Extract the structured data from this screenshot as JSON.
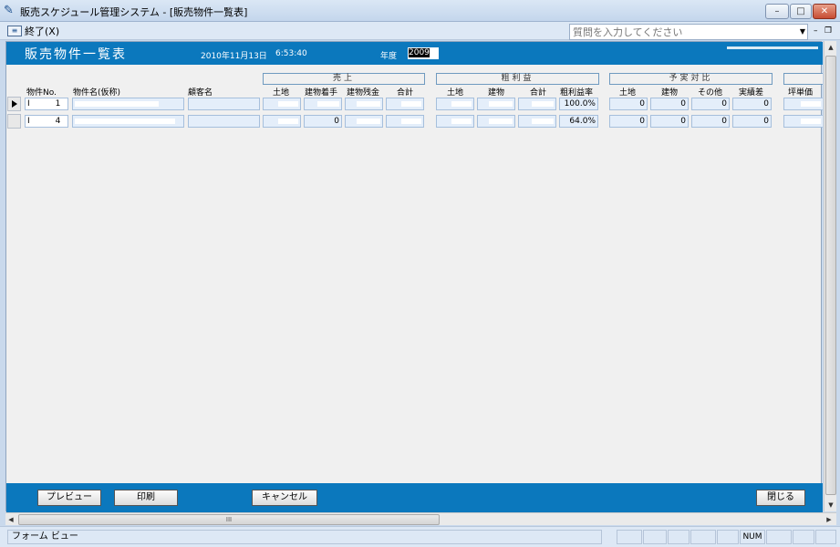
{
  "window": {
    "title": "販売スケジュール管理システム - [販売物件一覧表]",
    "min_glyph": "–",
    "max_glyph": "□",
    "close_glyph": "✕"
  },
  "menu": {
    "exit_label": "終了(X)",
    "help_placeholder": "質問を入力してください",
    "mdi_min": "–",
    "mdi_restore": "❐"
  },
  "header": {
    "title": "販売物件一覧表",
    "date": "2010年11月13日",
    "time": "6:53:40",
    "year_label": "年度",
    "year_value": "2009"
  },
  "groups": {
    "sales": "売上",
    "gross_profit": "粗利益",
    "budget_vs_actual": "予実対比"
  },
  "columns": {
    "property_no": "物件No.",
    "property_name": "物件名(仮称)",
    "customer": "顧客名",
    "sales_land": "土地",
    "sales_building_start": "建物着手",
    "sales_building_balance": "建物残金",
    "sales_total": "合計",
    "gp_land": "土地",
    "gp_building": "建物",
    "gp_total": "合計",
    "gp_rate": "粗利益率",
    "bva_land": "土地",
    "bva_building": "建物",
    "bva_other": "その他",
    "bva_diff": "実績差",
    "unit_price": "坪単価"
  },
  "rows": [
    {
      "no_prefix": "I",
      "no_suffix": "1",
      "sales_building_start": "",
      "sales_building_balance": "",
      "gp_rate": "100.0%",
      "bva_land": "0",
      "bva_building": "0",
      "bva_other": "0",
      "bva_diff": "0"
    },
    {
      "no_prefix": "I",
      "no_suffix": "4",
      "sales_building_start": "0",
      "sales_building_balance": "",
      "gp_rate": "64.0%",
      "bva_land": "0",
      "bva_building": "0",
      "bva_other": "0",
      "bva_diff": "0"
    }
  ],
  "footer": {
    "preview": "プレビュー",
    "print": "印刷",
    "cancel": "キャンセル",
    "close": "閉じる"
  },
  "scroll": {
    "h_thumb_grip": "III"
  },
  "status": {
    "mode": "フォーム ビュー",
    "num": "NUM"
  }
}
